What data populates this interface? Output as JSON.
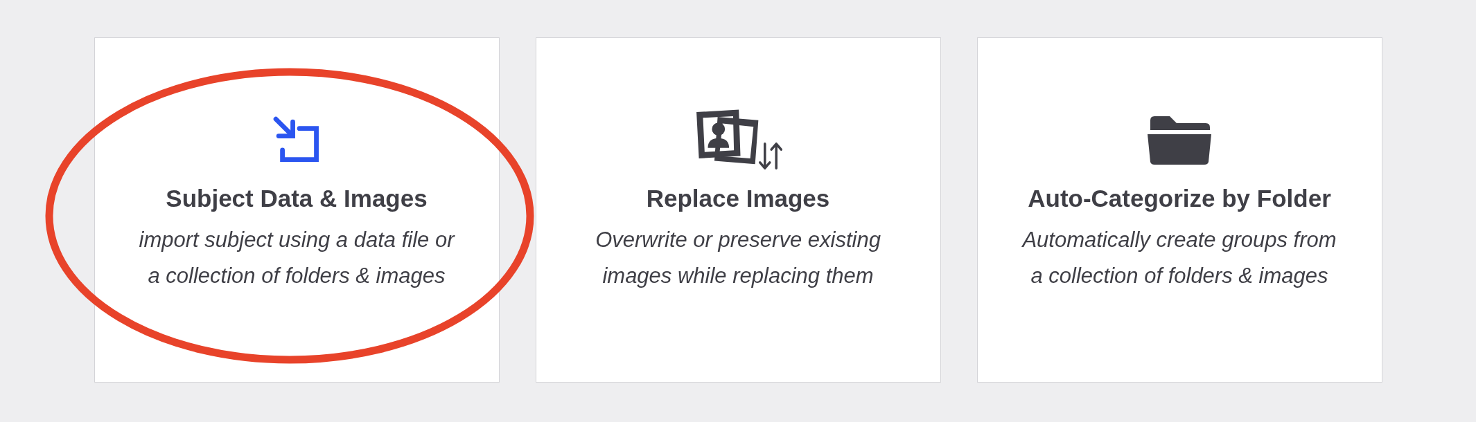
{
  "options": [
    {
      "kind": "import",
      "title": "Subject Data & Images",
      "description": "import subject using a data file or a collection of folders & images",
      "selected": true,
      "circled": true
    },
    {
      "kind": "replace",
      "title": "Replace Images",
      "description": "Overwrite or preserve existing images while replacing them",
      "selected": false,
      "circled": false
    },
    {
      "kind": "folder",
      "title": "Auto-Categorize by Folder",
      "description": "Automatically create groups from a collection of folders & images",
      "selected": false,
      "circled": false
    }
  ]
}
